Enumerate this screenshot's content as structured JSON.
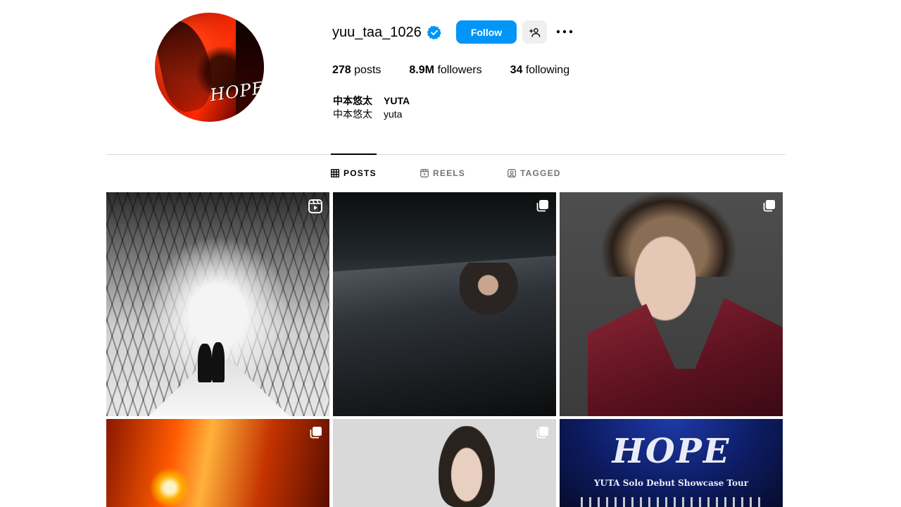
{
  "profile": {
    "username": "yuu_taa_1026",
    "verified": true,
    "follow_label": "Follow",
    "suggest_icon": "add-person-icon",
    "more_icon": "more-horizontal-icon",
    "avatar_text": "HOPE",
    "stats": {
      "posts_count": "278",
      "posts_label": "posts",
      "followers_count": "8.9M",
      "followers_label": "followers",
      "following_count": "34",
      "following_label": "following"
    },
    "full_name_jp": "中本悠太",
    "full_name_en": "YUTA",
    "bio_jp": "中本悠太",
    "bio_en": "yuta"
  },
  "tabs": [
    {
      "label": "POSTS",
      "icon": "grid-icon",
      "active": true
    },
    {
      "label": "REELS",
      "icon": "reels-icon",
      "active": false
    },
    {
      "label": "TAGGED",
      "icon": "tagged-icon",
      "active": false
    }
  ],
  "posts": [
    {
      "type": "reel",
      "badge_icon": "reel-icon",
      "description_color": "#e0e0e0"
    },
    {
      "type": "carousel",
      "badge_icon": "carousel-icon"
    },
    {
      "type": "carousel",
      "badge_icon": "carousel-icon"
    },
    {
      "type": "carousel",
      "badge_icon": "carousel-icon"
    },
    {
      "type": "carousel",
      "badge_icon": "carousel-icon"
    },
    {
      "type": "image",
      "text_title": "HOPE",
      "text_subtitle": "YUTA Solo Debut Showcase Tour"
    }
  ],
  "colors": {
    "accent": "#0095f6",
    "verified": "#0095f6",
    "tab_inactive": "#737373",
    "divider": "#dbdbdb"
  }
}
